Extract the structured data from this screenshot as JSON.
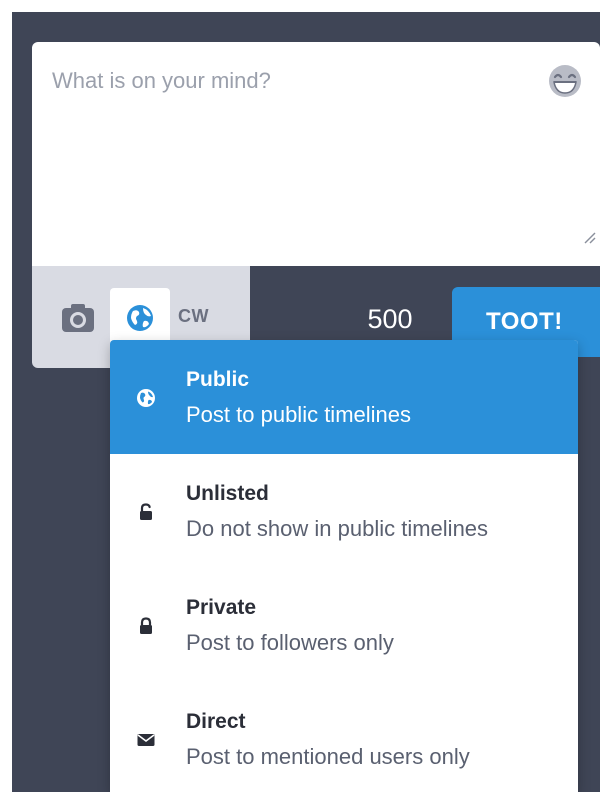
{
  "compose": {
    "placeholder": "What is on your mind?",
    "value": ""
  },
  "toolbar": {
    "cw_label": "CW",
    "char_count": "500",
    "toot_label": "TOOT!"
  },
  "privacy": {
    "selected": "Public",
    "options": [
      {
        "title": "Public",
        "description": "Post to public timelines",
        "icon": "globe-icon"
      },
      {
        "title": "Unlisted",
        "description": "Do not show in public timelines",
        "icon": "unlock-icon"
      },
      {
        "title": "Private",
        "description": "Post to followers only",
        "icon": "lock-icon"
      },
      {
        "title": "Direct",
        "description": "Post to mentioned users only",
        "icon": "envelope-icon"
      }
    ]
  },
  "icons": {
    "emoji": "emoji-laugh-icon",
    "media": "camera-icon",
    "privacy": "globe-icon",
    "resize": "resize-handle-icon"
  },
  "colors": {
    "accent": "#2b90d9",
    "app_background": "#3f4556",
    "toolbar_background": "#d9dbe3",
    "placeholder": "#9ba0ac",
    "icon_gray": "#6b7080"
  }
}
